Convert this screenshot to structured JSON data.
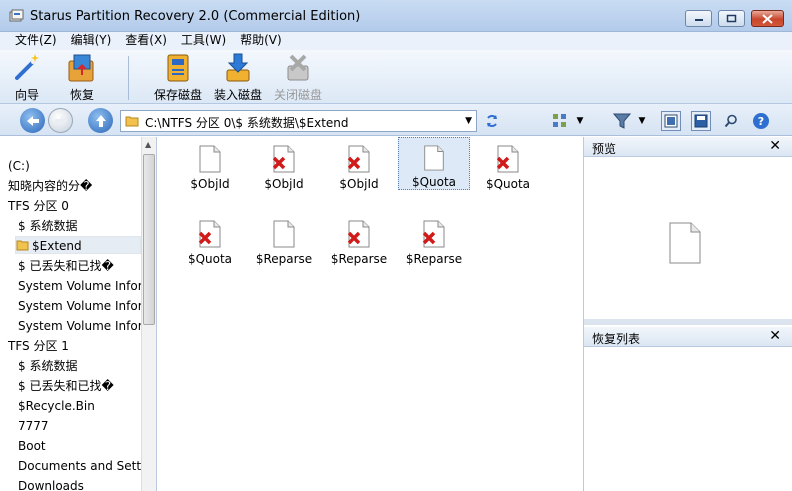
{
  "window": {
    "title": "Starus Partition Recovery 2.0 (Commercial Edition)",
    "minimize_icon": "minimize-icon",
    "maximize_icon": "maximize-icon",
    "close_icon": "close-icon"
  },
  "menu": [
    "文件(Z)",
    "编辑(Y)",
    "查看(X)",
    "工具(W)",
    "帮助(V)"
  ],
  "toolbar": {
    "wizard_label": "向导",
    "recover_label": "恢复",
    "save_disk_label": "保存磁盘",
    "load_disk_label": "装入磁盘",
    "close_disk_label": "关闭磁盘"
  },
  "address": {
    "path": "C:\\NTFS 分区 0\\$ 系统数据\\$Extend"
  },
  "tree": [
    "(C:)",
    "知晓内容的分�",
    "TFS 分区 0",
    "$ 系统数据",
    "$Extend",
    "$ 已丢失和已找�",
    "System Volume Inform",
    "System Volume Inform",
    "System Volume Inform",
    "TFS 分区 1",
    "$ 系统数据",
    "$ 已丢失和已找�",
    "$Recycle.Bin",
    "7777",
    "Boot",
    "Documents and Setting",
    "Downloads"
  ],
  "files": [
    {
      "name": "$ObjId",
      "deleted": false
    },
    {
      "name": "$ObjId",
      "deleted": true
    },
    {
      "name": "$ObjId",
      "deleted": true
    },
    {
      "name": "$Quota",
      "deleted": false,
      "selected": true
    },
    {
      "name": "$Quota",
      "deleted": true
    },
    {
      "name": "$Quota",
      "deleted": true
    },
    {
      "name": "$Reparse",
      "deleted": false
    },
    {
      "name": "$Reparse",
      "deleted": true
    },
    {
      "name": "$Reparse",
      "deleted": true
    }
  ],
  "panels": {
    "preview_title": "预览",
    "recovery_list_title": "恢复列表",
    "close_glyph": "✕"
  },
  "colors": {
    "accent": "#1f6fd1",
    "deleted_mark": "#d11a1a"
  }
}
